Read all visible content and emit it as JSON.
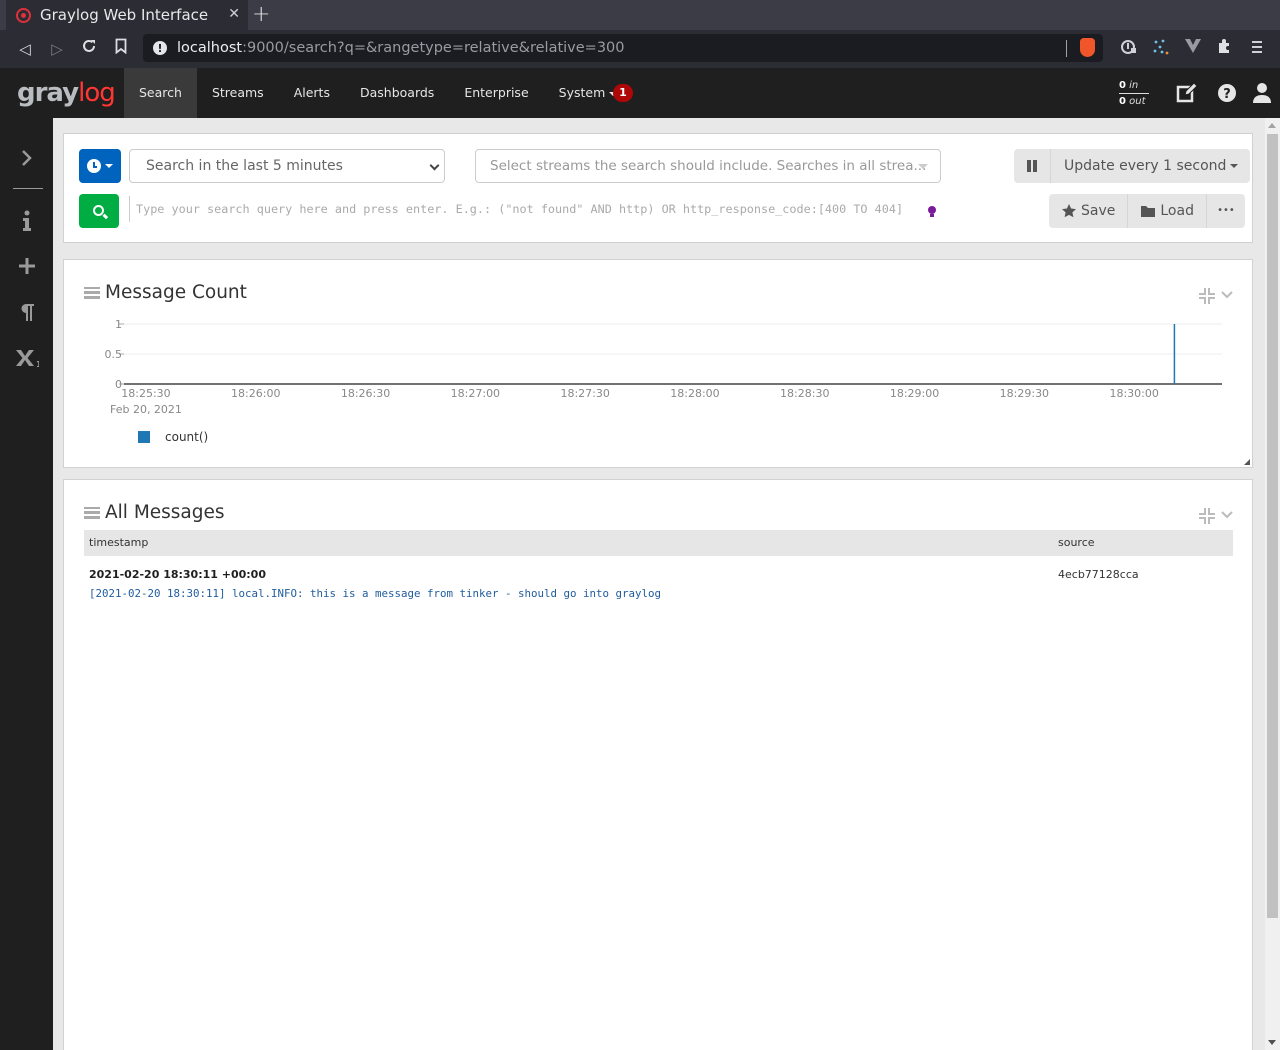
{
  "browser": {
    "tab_title": "Graylog Web Interface",
    "url_host": "localhost",
    "url_rest": ":9000/search?q=&rangetype=relative&relative=300",
    "icons": [
      "back-icon",
      "forward-icon",
      "reload-icon",
      "bookmark-icon",
      "site-info-icon",
      "brave-shields-icon",
      "extension-icon",
      "menu-icon"
    ]
  },
  "nav": {
    "logo_gray": "gray",
    "logo_red": "log",
    "items": [
      {
        "label": "Search",
        "active": true
      },
      {
        "label": "Streams"
      },
      {
        "label": "Alerts"
      },
      {
        "label": "Dashboards"
      },
      {
        "label": "Enterprise"
      },
      {
        "label": "System"
      }
    ],
    "notification_count": "1",
    "throughput": {
      "in_value": "0",
      "in_label": "in",
      "out_value": "0",
      "out_label": "out"
    }
  },
  "sidebar": {
    "icons": [
      "expand-chevron-icon",
      "info-icon",
      "add-icon",
      "paragraph-icon",
      "subscript-icon"
    ]
  },
  "search": {
    "time_range": "Search in the last 5 minutes",
    "streams_placeholder": "Select streams the search should include. Searches in all strea...",
    "query_placeholder": "Type your search query here and press enter. E.g.: (\"not found\" AND http) OR http_response_code:[400 TO 404]",
    "refresh_label": "Update every 1 second",
    "save_label": "Save",
    "load_label": "Load",
    "more_label": "•••"
  },
  "message_count": {
    "title": "Message Count",
    "legend": "count()",
    "series_color": "#1f77b4"
  },
  "chart_data": {
    "type": "bar",
    "title": "Message Count",
    "xlabel": "",
    "ylabel": "",
    "x_ticks": [
      "18:25:30",
      "18:26:00",
      "18:26:30",
      "18:27:00",
      "18:27:30",
      "18:28:00",
      "18:28:30",
      "18:29:00",
      "18:29:30",
      "18:30:00"
    ],
    "x_tick_sublabel": "Feb 20, 2021",
    "y_ticks": [
      0,
      0.5,
      1
    ],
    "ylim": [
      0,
      1
    ],
    "xlim": [
      "18:25:24",
      "18:30:24"
    ],
    "grid": true,
    "legend_placement": "bottom-left",
    "series": [
      {
        "name": "count()",
        "points": [
          {
            "x": "18:30:11",
            "y": 1
          }
        ]
      }
    ]
  },
  "all_messages": {
    "title": "All Messages",
    "columns": [
      "timestamp",
      "source"
    ],
    "rows": [
      {
        "timestamp": "2021-02-20 18:30:11 +00:00",
        "source": "4ecb77128cca",
        "message": "[2021-02-20 18:30:11] local.INFO: this is a message from tinker - should go into graylog"
      }
    ]
  }
}
